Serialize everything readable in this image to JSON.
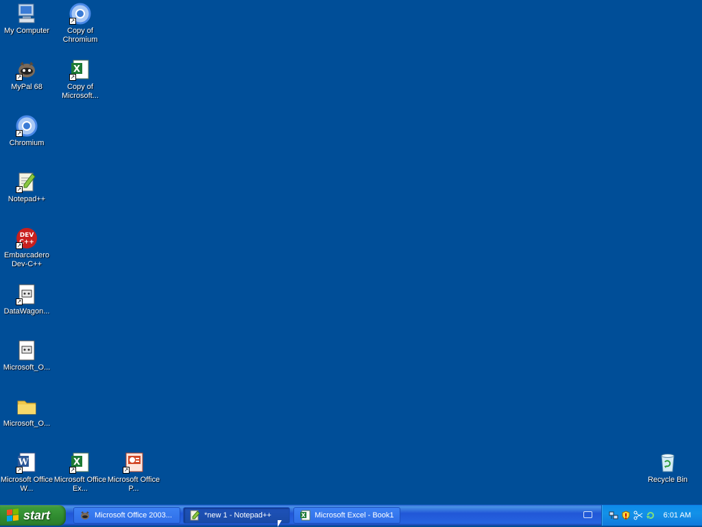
{
  "desktop": {
    "icons": [
      {
        "label": "My Computer",
        "icon": "my-computer-icon"
      },
      {
        "label": "Copy of Chromium",
        "icon": "chromium-icon"
      },
      {
        "label": "MyPal 68",
        "icon": "mypal-icon"
      },
      {
        "label": "Copy of Microsoft...",
        "icon": "excel-icon"
      },
      {
        "label": "Chromium",
        "icon": "chromium-icon"
      },
      {
        "label": "Notepad++",
        "icon": "notepadpp-icon"
      },
      {
        "label": "Embarcadero Dev-C++",
        "icon": "devcpp-icon"
      },
      {
        "label": "DataWagon...",
        "icon": "exe-icon"
      },
      {
        "label": "Microsoft_O...",
        "icon": "exe-icon"
      },
      {
        "label": "Microsoft_O...",
        "icon": "folder-icon"
      },
      {
        "label": "Microsoft Office W...",
        "icon": "word-icon"
      },
      {
        "label": "Microsoft Office Ex...",
        "icon": "excel-icon"
      },
      {
        "label": "Microsoft Office P...",
        "icon": "powerpoint-icon"
      },
      {
        "label": "Recycle Bin",
        "icon": "recycle-bin-icon"
      }
    ]
  },
  "taskbar": {
    "start_label": "start",
    "tasks": [
      {
        "label": "Microsoft Office 2003...",
        "icon": "setup-icon",
        "active": false
      },
      {
        "label": "*new 1 - Notepad++",
        "icon": "notepadpp-icon",
        "active": true
      },
      {
        "label": "Microsoft Excel - Book1",
        "icon": "excel-icon",
        "active": false
      }
    ],
    "tray": {
      "icons": [
        "network-icon",
        "security-shield-icon",
        "scissors-icon",
        "refresh-icon"
      ],
      "clock": "6:01 AM"
    },
    "keyboard_icon": "keyboard-icon"
  },
  "colors": {
    "desktop_bg": "#004e98",
    "taskbar_blue": "#2157d7",
    "start_green": "#3c9b3a"
  }
}
